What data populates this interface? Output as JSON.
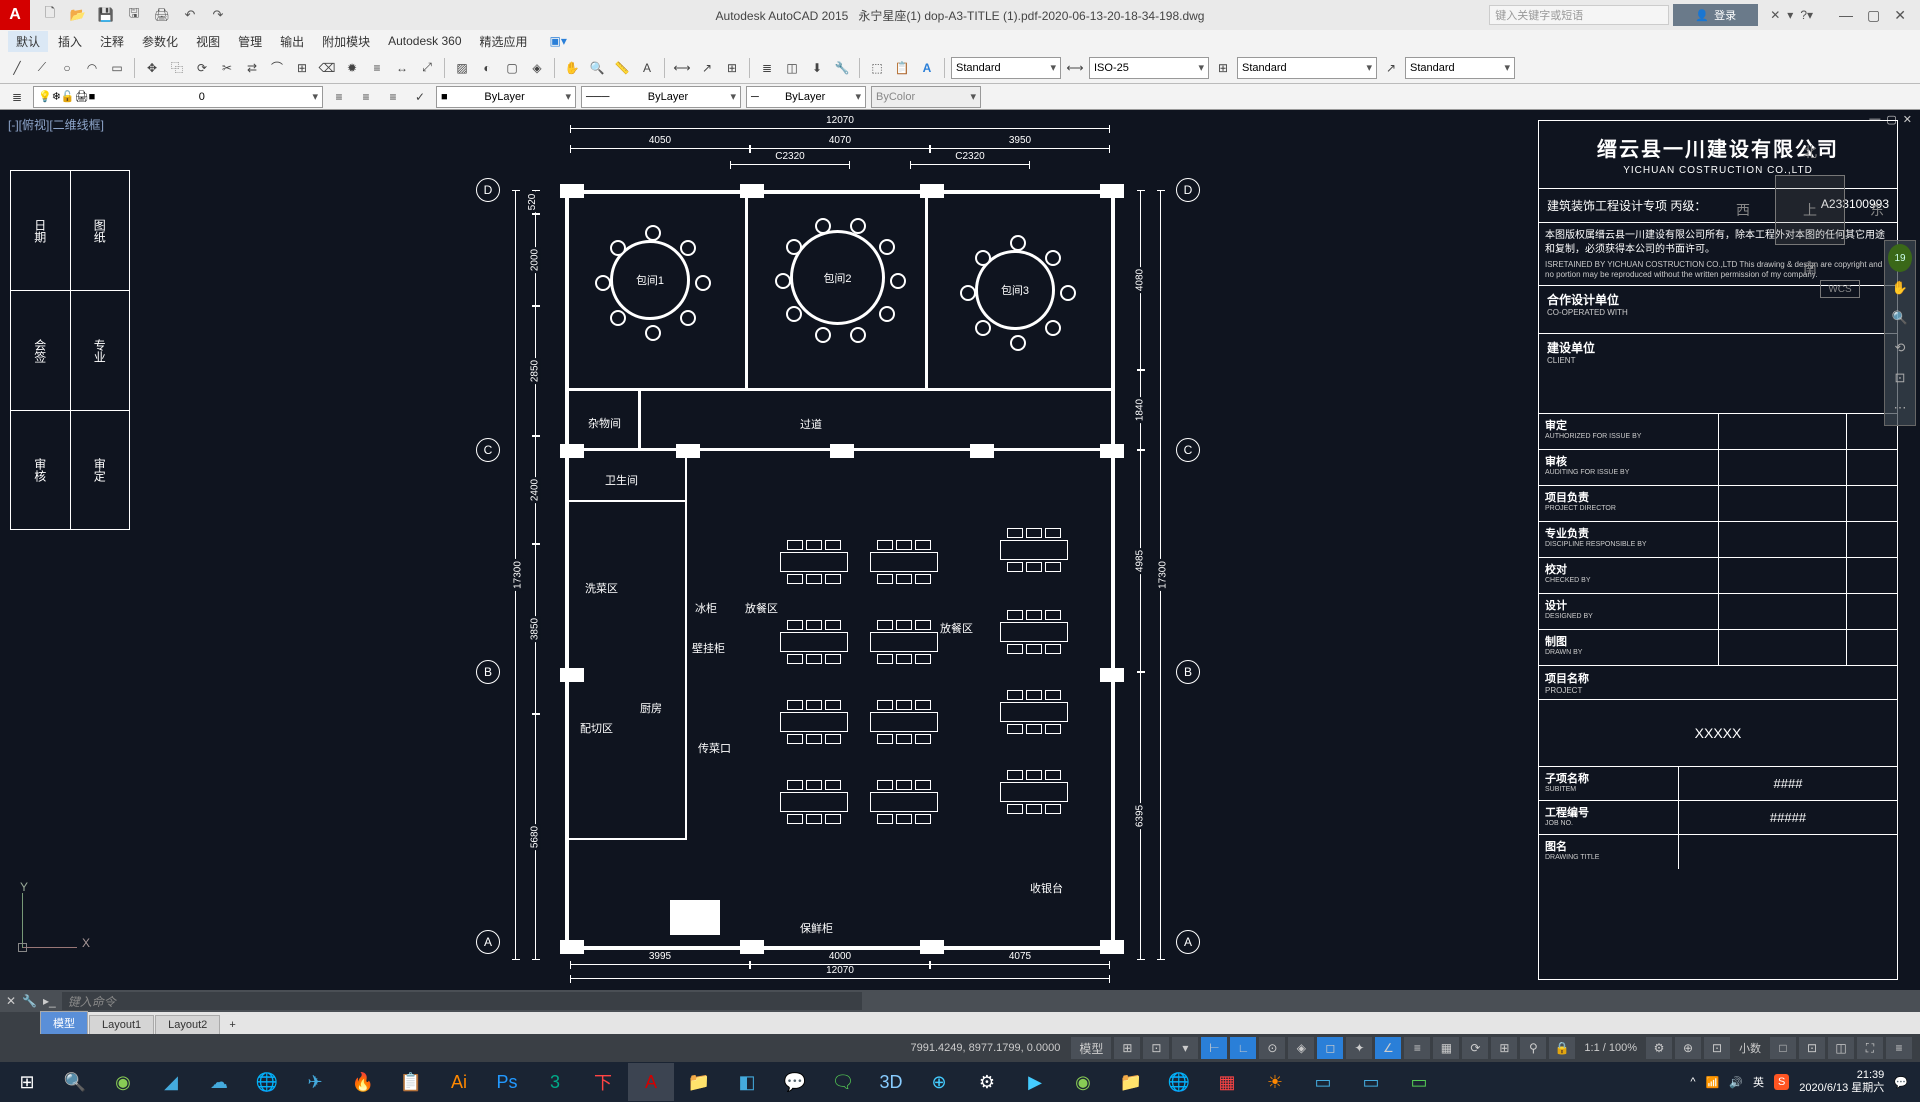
{
  "title": {
    "app": "Autodesk AutoCAD 2015",
    "file": "永宁星座(1) dop-A3-TITLE (1).pdf-2020-06-13-20-18-34-198.dwg"
  },
  "qat_search_placeholder": "键入关键字或短语",
  "login": "登录",
  "menus": [
    "默认",
    "插入",
    "注释",
    "参数化",
    "视图",
    "管理",
    "输出",
    "附加模块",
    "Autodesk 360",
    "精选应用"
  ],
  "combos": {
    "textstyle": "Standard",
    "dimstyle": "ISO-25",
    "tablestyle": "Standard",
    "mlstyle": "Standard",
    "layer": "0",
    "linetype": "ByLayer",
    "lineweight": "ByLayer",
    "color": "ByLayer",
    "plotstyle": "ByColor"
  },
  "vp_label": "[-][俯视][二维线框]",
  "viewcube": {
    "n": "北",
    "s": "南",
    "e": "东",
    "w": "西",
    "top": "上"
  },
  "wcs": "WCS",
  "grid_labels": [
    "A",
    "B",
    "C",
    "D"
  ],
  "dims": {
    "total_w": "12070",
    "w1": "4050",
    "w2": "4070",
    "w3": "3950",
    "c1": "C2320",
    "c2": "C2320",
    "total_h": "17300",
    "h1": "520",
    "h2": "2000",
    "h3": "2850",
    "h4": "2400",
    "h5": "3850",
    "h6": "5680",
    "rh1": "4080",
    "rh2": "1840",
    "rh3": "4985",
    "rh4": "6395",
    "bw1": "3995",
    "bw2": "4000",
    "bw3": "4075"
  },
  "rooms": {
    "r1": "包间1",
    "r2": "包间2",
    "r3": "包间3",
    "storage": "杂物间",
    "corridor": "过道",
    "toilet": "卫生间",
    "wash": "洗菜区",
    "fridge": "冰柜",
    "prep": "配切区",
    "kitchen": "厨房",
    "cab": "壁挂柜",
    "pass": "传菜口",
    "dine1": "放餐区",
    "dine2": "放餐区",
    "cashier": "收银台",
    "fresh": "保鲜柜"
  },
  "left_panel": [
    [
      "日期",
      "图纸"
    ],
    [
      "会签",
      "专业"
    ],
    [
      "审核",
      "审定"
    ]
  ],
  "titleblock": {
    "company": "缙云县一川建设有限公司",
    "company_en": "YICHUAN COSTRUCTION CO.,LTD",
    "cert_label": "建筑装饰工程设计专项  丙级：",
    "cert_no": "A233100993",
    "copy_cn": "本图版权属缙云县一川建设有限公司所有，除本工程外对本图的任何其它用途和复制，必须获得本公司的书面许可。",
    "copy_en": "ISRETAINED BY YICHUAN COSTRUCTION CO.,LTD\nThis drawing & design are copyright and no portion may be reproduced without the written permission of my company.",
    "coop": "合作设计单位",
    "coop_en": "CO-OPERATED WITH",
    "client": "建设单位",
    "client_en": "CLIENT",
    "rows": [
      {
        "t": "审定",
        "e": "AUTHORIZED FOR ISSUE BY"
      },
      {
        "t": "审核",
        "e": "AUDITING FOR ISSUE BY"
      },
      {
        "t": "项目负责",
        "e": "PROJECT DIRECTOR"
      },
      {
        "t": "专业负责",
        "e": "DISCIPLINE RESPONSIBLE BY"
      },
      {
        "t": "校对",
        "e": "CHECKED BY"
      },
      {
        "t": "设计",
        "e": "DESIGNED BY"
      },
      {
        "t": "制图",
        "e": "DRAWN BY"
      }
    ],
    "proj": "项目名称",
    "proj_en": "PROJECT",
    "proj_val": "XXXXX",
    "sub": "子项名称",
    "sub_en": "SUBITEM",
    "sub_v": "####",
    "job": "工程编号",
    "job_en": "JOB NO.",
    "job_v": "#####",
    "dname": "图名",
    "dname_en": "DRAWING TITLE"
  },
  "cmd_placeholder": "键入命令",
  "tabs": [
    "模型",
    "Layout1",
    "Layout2"
  ],
  "status": {
    "coords": "7991.4249, 8977.1799, 0.0000",
    "model": "模型",
    "scale": "1:1 / 100%",
    "dec": "小数"
  },
  "tray": {
    "lang": "英",
    "time": "21:39",
    "date": "2020/6/13 星期六"
  }
}
